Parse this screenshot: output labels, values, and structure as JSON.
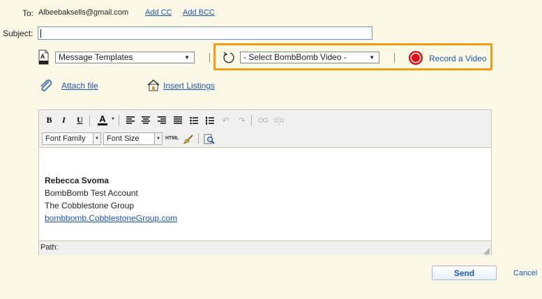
{
  "header": {
    "to_label": "To:",
    "to_value": "Albeebaksells@gmail.com",
    "add_cc": "Add CC",
    "add_bcc": "Add BCC",
    "subject_label": "Subject:",
    "subject_value": ""
  },
  "templates": {
    "icon": "document-a-icon",
    "selected": "Message Templates"
  },
  "bombbomb": {
    "refresh_icon": "refresh-icon",
    "video_select": "- Select BombBomb Video -",
    "record_icon": "record-icon",
    "record_label": "Record a Video",
    "highlight_color": "#f59a14"
  },
  "attachments": {
    "attach_label": "Attach file",
    "listings_label": "Insert Listings"
  },
  "toolbar": {
    "bold": "B",
    "italic": "I",
    "underline": "U",
    "font_color": "A",
    "font_family": "Font Family",
    "font_size": "Font Size",
    "html": "HTML"
  },
  "editor": {
    "signature_name": "Rebecca Svoma",
    "line2": "BombBomb Test Account",
    "line3": "The Cobblestone Group",
    "website": "bombbomb.CobblestoneGroup.com",
    "path_label": "Path:"
  },
  "actions": {
    "send": "Send",
    "cancel": "Cancel"
  }
}
